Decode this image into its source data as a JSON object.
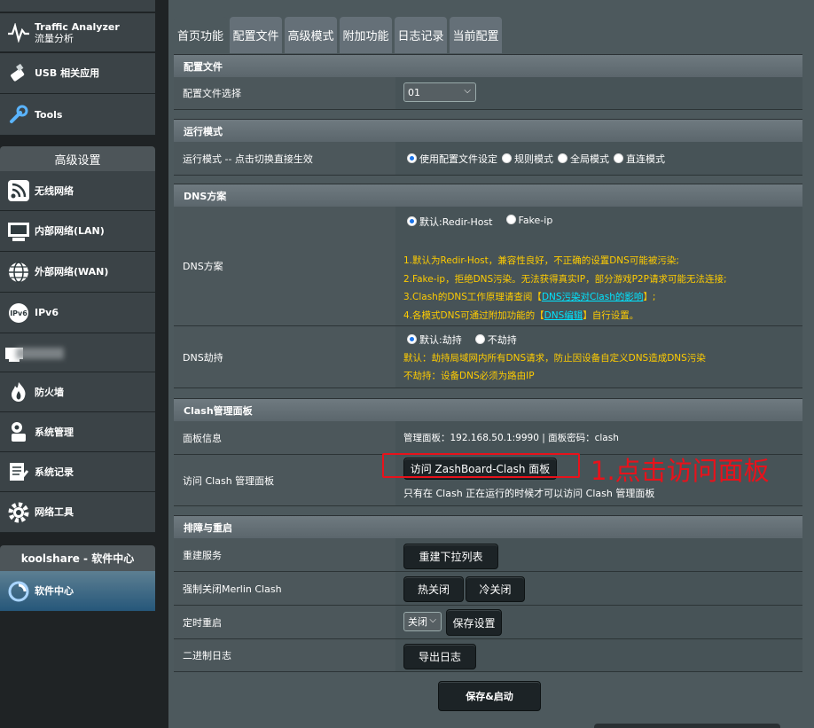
{
  "sidebar": {
    "top_items": [
      {
        "label": "Traffic Analyzer",
        "sub": "流量分析",
        "icon": "traffic-analyzer-icon"
      },
      {
        "label": "USB 相关应用",
        "icon": "usb-icon"
      },
      {
        "label": "Tools",
        "icon": "wrench-icon"
      }
    ],
    "advanced_header": "高级设置",
    "advanced_items": [
      {
        "label": "无线网络",
        "icon": "wireless-icon"
      },
      {
        "label": "内部网络(LAN)",
        "icon": "lan-icon"
      },
      {
        "label": "外部网络(WAN)",
        "icon": "wan-globe-icon"
      },
      {
        "label": "IPv6",
        "icon": "ipv6-icon"
      },
      {
        "label": "",
        "icon": "vpn-icon"
      },
      {
        "label": "防火墙",
        "icon": "firewall-icon"
      },
      {
        "label": "系统管理",
        "icon": "admin-icon"
      },
      {
        "label": "系统记录",
        "icon": "log-icon"
      },
      {
        "label": "网络工具",
        "icon": "gear-icon"
      }
    ],
    "software_header": "koolshare - 软件中心",
    "software_item": {
      "label": "软件中心",
      "icon": "software-center-icon"
    }
  },
  "tabs": [
    "首页功能",
    "配置文件",
    "高级模式",
    "附加功能",
    "日志记录",
    "当前配置"
  ],
  "config": {
    "header": "配置文件",
    "label": "配置文件选择",
    "selected": "01"
  },
  "run_mode": {
    "header": "运行模式",
    "label": "运行模式 -- 点击切换直接生效",
    "options": [
      "使用配置文件设定",
      "规则模式",
      "全局模式",
      "直连模式"
    ]
  },
  "dns": {
    "header": "DNS方案",
    "label": "DNS方案",
    "options": [
      "默认:Redir-Host",
      "Fake-ip"
    ],
    "notes": [
      "1.默认为Redir-Host，兼容性良好，不正确的设置DNS可能被污染;",
      "2.Fake-ip，拒绝DNS污染。无法获得真实IP，部分游戏P2P请求可能无法连接;"
    ],
    "note3_prefix": "3.Clash的DNS工作原理请查阅【",
    "note3_link": "DNS污染对Clash的影响",
    "note3_suffix": "】;",
    "note4_prefix": "4.各模式DNS可通过附加功能的【",
    "note4_link": "DNS编辑",
    "note4_suffix": "】自行设置。",
    "hijack_label": "DNS劫持",
    "hijack_options": [
      "默认:劫持",
      "不劫持"
    ],
    "hijack_note1": "默认：劫持局域网内所有DNS请求，防止因设备自定义DNS造成DNS污染",
    "hijack_note2": "不劫持：设备DNS必须为路由IP"
  },
  "panel": {
    "header": "Clash管理面板",
    "info_label": "面板信息",
    "info_text": "管理面板：192.168.50.1:9990 | 面板密码：clash",
    "info_sep": "|",
    "access_label": "访问 Clash 管理面板",
    "access_button": "访问 ZashBoard-Clash 面板",
    "access_note": "只有在 Clash 正在运行的时候才可以访问 Clash 管理面板",
    "annotation": "1.点击访问面板",
    "annotation_color": "#e8121b"
  },
  "troubleshoot": {
    "header": "排障与重启",
    "rebuild_label": "重建服务",
    "rebuild_button": "重建下拉列表",
    "forceclose_label": "强制关闭Merlin Clash",
    "hot_close": "热关闭",
    "cold_close": "冷关闭",
    "restart_label": "定时重启",
    "restart_select": "关闭",
    "save_settings": "保存设置",
    "binlog_label": "二进制日志",
    "export_log": "导出日志"
  },
  "save_start": "保存&启动"
}
